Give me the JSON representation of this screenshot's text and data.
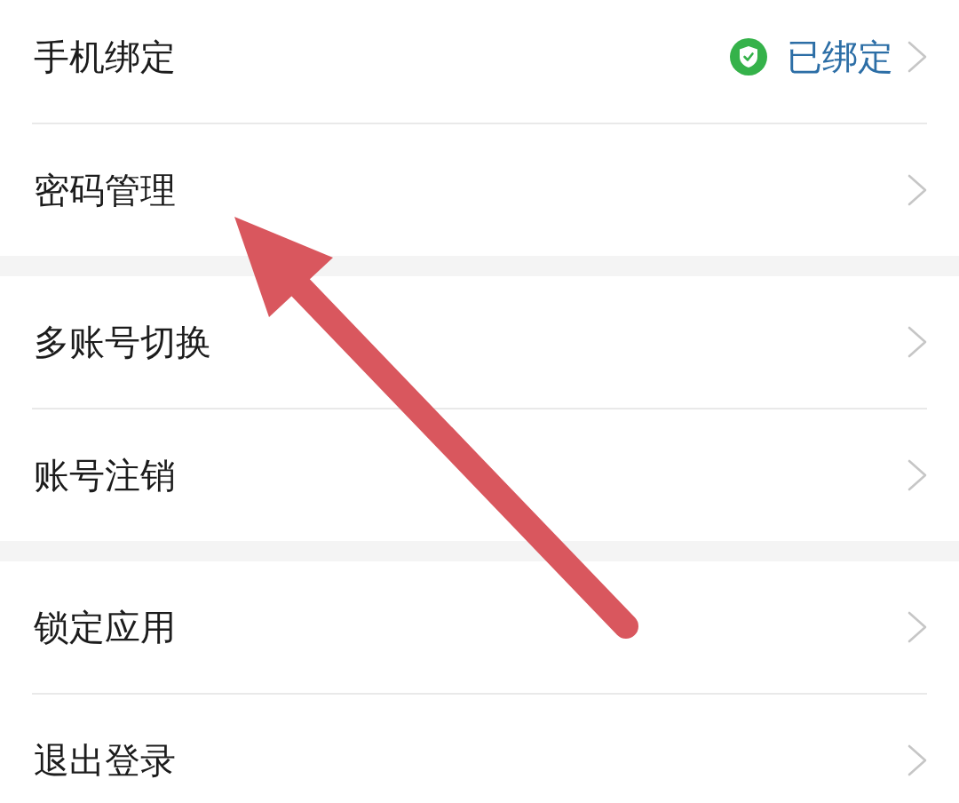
{
  "settings_groups": [
    {
      "items": [
        {
          "label": "手机绑定",
          "status": {
            "text": "已绑定",
            "verified": true
          }
        },
        {
          "label": "密码管理"
        }
      ]
    },
    {
      "items": [
        {
          "label": "多账号切换"
        },
        {
          "label": "账号注销"
        }
      ]
    },
    {
      "items": [
        {
          "label": "锁定应用"
        },
        {
          "label": "退出登录"
        }
      ]
    }
  ],
  "annotations": [
    {
      "kind": "arrow"
    }
  ]
}
